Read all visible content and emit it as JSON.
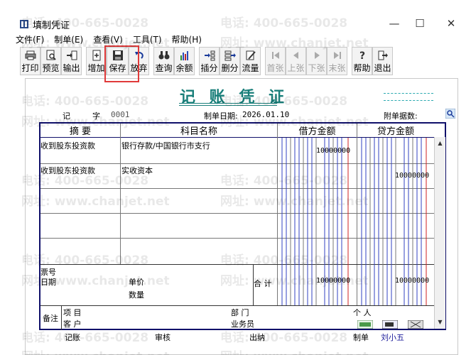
{
  "window": {
    "title": "填制凭证",
    "minimize": "—",
    "maximize": "☐",
    "close": "✕"
  },
  "menu": [
    "文件(F)",
    "制单(E)",
    "查看(V)",
    "工具(T)",
    "帮助(H)"
  ],
  "toolbar": {
    "buttons": [
      {
        "label": "打印",
        "icon": "printer-icon",
        "enabled": true
      },
      {
        "label": "预览",
        "icon": "preview-icon",
        "enabled": true
      },
      {
        "label": "输出",
        "icon": "export-icon",
        "enabled": true
      },
      {
        "label": "增加",
        "icon": "add-icon",
        "enabled": true
      },
      {
        "label": "保存",
        "icon": "save-icon",
        "enabled": true
      },
      {
        "label": "放弃",
        "icon": "undo-icon",
        "enabled": true
      },
      {
        "label": "查询",
        "icon": "binoculars-icon",
        "enabled": true
      },
      {
        "label": "余额",
        "icon": "bar-chart-icon",
        "enabled": true
      },
      {
        "label": "插分",
        "icon": "insert-row-icon",
        "enabled": true
      },
      {
        "label": "删分",
        "icon": "delete-row-icon",
        "enabled": true
      },
      {
        "label": "流量",
        "icon": "pencil-icon",
        "enabled": true
      },
      {
        "label": "首张",
        "icon": "first-icon",
        "enabled": false
      },
      {
        "label": "上张",
        "icon": "prev-icon",
        "enabled": false
      },
      {
        "label": "下张",
        "icon": "next-icon",
        "enabled": false
      },
      {
        "label": "末张",
        "icon": "last-icon",
        "enabled": false
      },
      {
        "label": "帮助",
        "icon": "help-icon",
        "enabled": true
      },
      {
        "label": "退出",
        "icon": "exit-icon",
        "enabled": true
      }
    ]
  },
  "voucher": {
    "title": "记 账 凭 证",
    "type_label": "记",
    "number_label": "字",
    "number": "0001",
    "date_label": "制单日期:",
    "date": "2026.01.10",
    "attach_label": "附单据数:",
    "columns": {
      "summary": "摘 要",
      "subject": "科目名称",
      "debit": "借方金额",
      "credit": "贷方金额"
    },
    "rows": [
      {
        "summary": "收到股东投资款",
        "subject": "银行存款/中国银行市支行",
        "debit": "10000000",
        "credit": ""
      },
      {
        "summary": "收到股东投资款",
        "subject": "实收资本",
        "debit": "",
        "credit": "10000000"
      },
      {
        "summary": "",
        "subject": "",
        "debit": "",
        "credit": ""
      },
      {
        "summary": "",
        "subject": "",
        "debit": "",
        "credit": ""
      }
    ],
    "bill_no_label": "票号",
    "bill_date_label": "日期",
    "unit_price_label": "单价",
    "quantity_label": "数量",
    "total_label": "合 计",
    "total_debit": "10000000",
    "total_credit": "10000000",
    "remark_label": "备注",
    "project_label": "项   目",
    "customer_label": "客   户",
    "dept_label": "部    门",
    "person_label": "个    人",
    "salesman_label": "业务员",
    "footer": {
      "bookkeeping": "记账",
      "audit": "审核",
      "cashier": "出纳",
      "maker_label": "制单",
      "maker": "刘小五"
    }
  },
  "watermark": {
    "phone": "电话: 400-665-0028",
    "site": "网址: www.chanjet.net"
  },
  "colors": {
    "title": "#1a7f7a",
    "grid_border": "#10106a",
    "highlight": "#e03a3a",
    "digit_line_blue": "#3040c0",
    "digit_line_red": "#d02020"
  }
}
